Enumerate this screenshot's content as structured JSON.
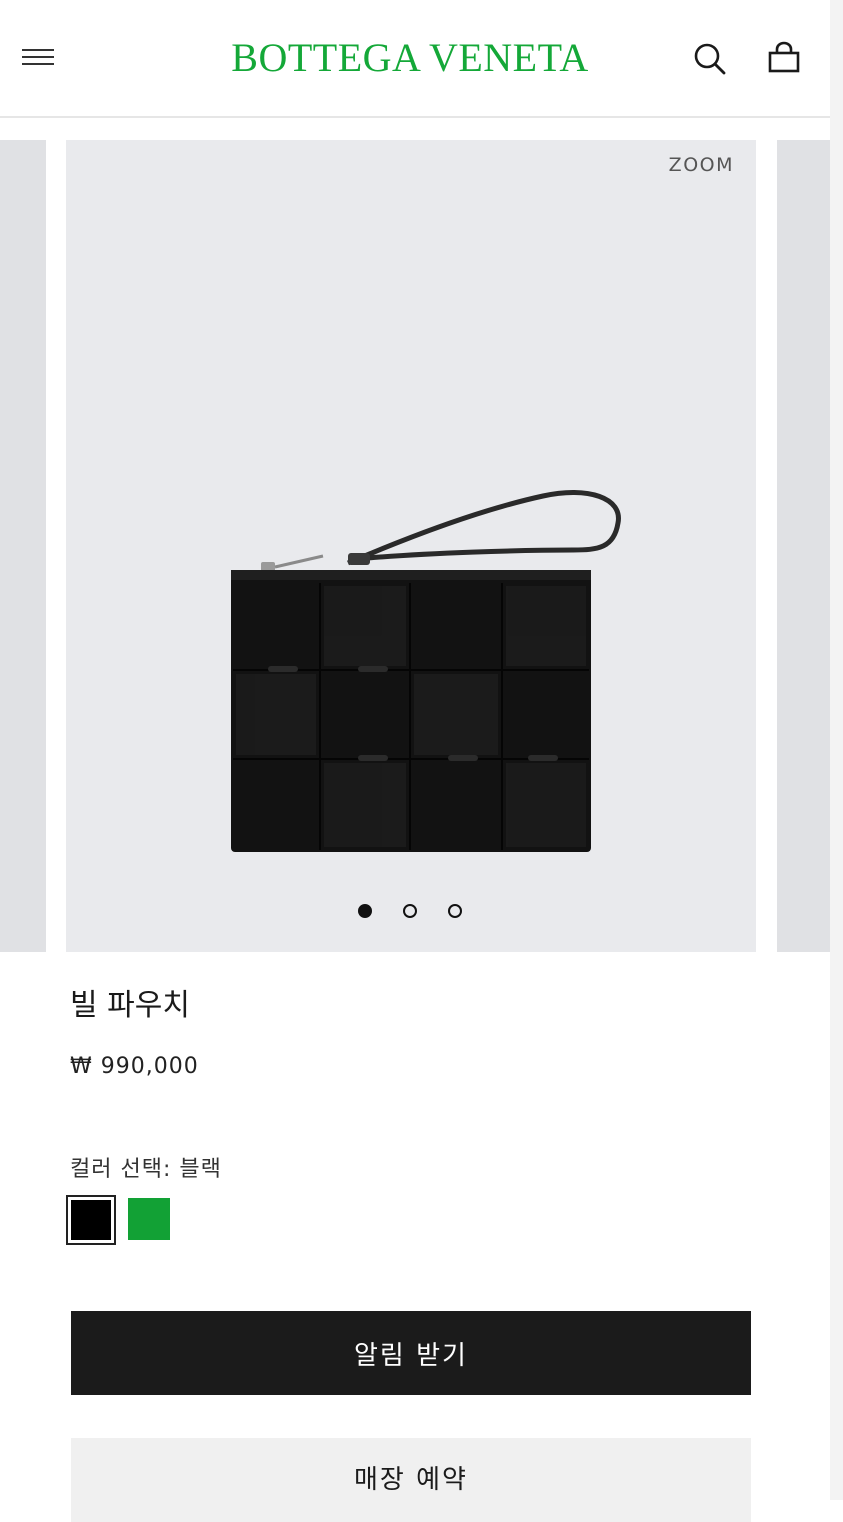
{
  "header": {
    "brand": "BOTTEGA VENETA",
    "brand_color": "#14a838",
    "icons": [
      "hamburger-menu-icon",
      "search-icon",
      "shopping-bag-icon"
    ]
  },
  "gallery": {
    "zoom_label": "ZOOM",
    "slide_count": 3,
    "active_slide": 1
  },
  "product": {
    "name": "빌 파우치",
    "price": "₩ 990,000",
    "color_label": "컬러 선택: 블랙",
    "colors": [
      {
        "name": "블랙",
        "hex": "#000000",
        "selected": true
      },
      {
        "name": "그린",
        "hex": "#12a135",
        "selected": false
      }
    ]
  },
  "actions": {
    "notify_label": "알림 받기",
    "store_label": "매장 예약"
  }
}
